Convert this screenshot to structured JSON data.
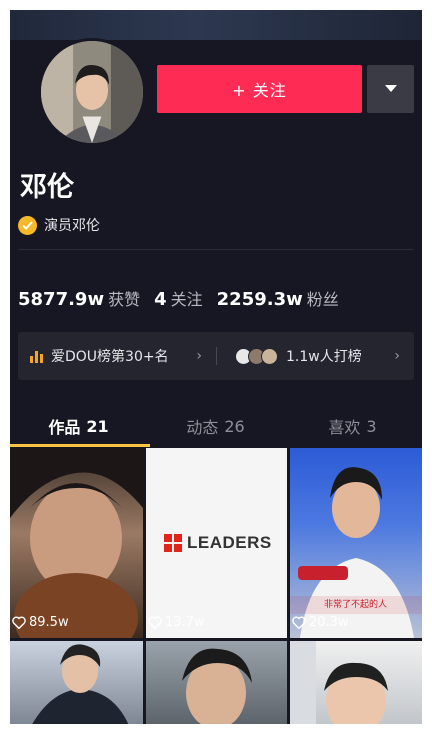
{
  "profile": {
    "name": "邓伦",
    "verified_label": "演员邓伦",
    "follow_label": "+ 关注",
    "more_icon": "caret-down-icon"
  },
  "stats": [
    {
      "value": "5877.9w",
      "label": "获赞"
    },
    {
      "value": "4",
      "label": "关注"
    },
    {
      "value": "2259.3w",
      "label": "粉丝"
    }
  ],
  "rank": {
    "left_label": "爱DOU榜第30+名",
    "right_label": "1.1w人打榜"
  },
  "tabs": [
    {
      "label": "作品",
      "count": "21"
    },
    {
      "label": "动态",
      "count": "26"
    },
    {
      "label": "喜欢",
      "count": "3"
    }
  ],
  "videos": [
    {
      "likes": "89.5w"
    },
    {
      "likes": "13.7w",
      "brand": "LEADERS"
    },
    {
      "likes": "20.3w",
      "caption": "非常了不起的人"
    },
    {},
    {},
    {}
  ],
  "colors": {
    "background": "#161722",
    "follow_button": "#fe2c55",
    "tab_indicator": "#f6c441",
    "verify_badge": "#f7b928"
  }
}
